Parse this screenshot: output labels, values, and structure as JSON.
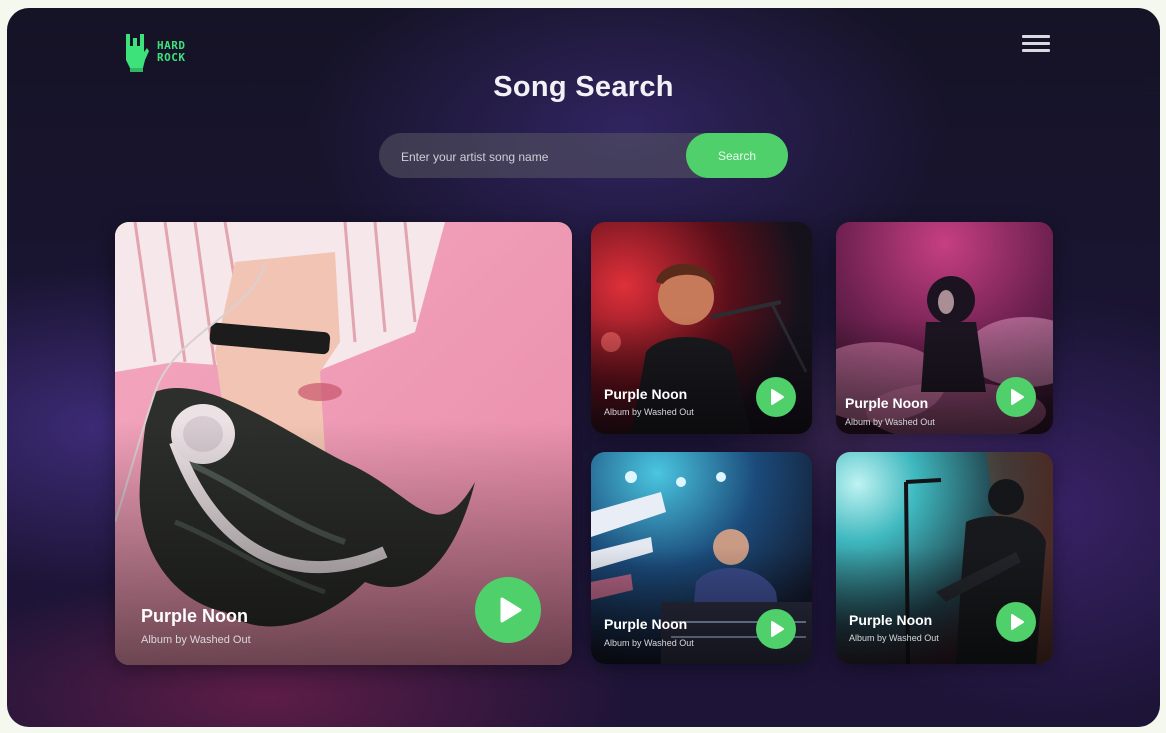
{
  "brand": {
    "logo_text": "HARD ROCK",
    "accent_color": "#4fd06b",
    "logo_icon": "rock-hand-icon"
  },
  "header": {
    "title": "Song Search",
    "menu_icon": "hamburger-menu-icon"
  },
  "search": {
    "placeholder": "Enter your artist song name",
    "value": "",
    "button_label": "Search"
  },
  "cards": [
    {
      "title": "Purple Noon",
      "subtitle": "Album by Washed Out",
      "image": "woman-with-headphones-on-pink",
      "play_icon": "play-icon"
    },
    {
      "title": "Purple Noon",
      "subtitle": "Album by Washed Out",
      "image": "singer-at-microphone-red-light",
      "play_icon": "play-icon"
    },
    {
      "title": "Purple Noon",
      "subtitle": "Album by Washed Out",
      "image": "performer-in-pink-smoke",
      "play_icon": "play-icon"
    },
    {
      "title": "Purple Noon",
      "subtitle": "Album by Washed Out",
      "image": "dj-at-console-blue-lights",
      "play_icon": "play-icon"
    },
    {
      "title": "Purple Noon",
      "subtitle": "Album by Washed Out",
      "image": "guitarist-silhouette-spotlight",
      "play_icon": "play-icon"
    }
  ]
}
